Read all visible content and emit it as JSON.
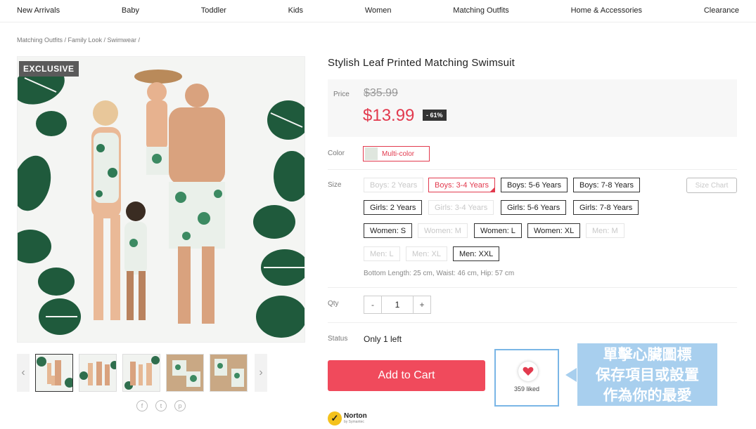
{
  "nav": [
    "New Arrivals",
    "Baby",
    "Toddler",
    "Kids",
    "Women",
    "Matching Outfits",
    "Home & Accessories",
    "Clearance"
  ],
  "breadcrumb": "Matching Outfits / Family Look / Swimwear /",
  "product": {
    "badge": "EXCLUSIVE",
    "title": "Stylish Leaf Printed Matching Swimsuit",
    "price_label": "Price",
    "old_price": "$35.99",
    "price": "$13.99",
    "discount": "- 61%",
    "color_label": "Color",
    "color": "Multi-color",
    "size_label": "Size",
    "size_chart": "Size Chart",
    "sizes": [
      [
        "Boys: 2 Years",
        "Boys: 3-4 Years",
        "Boys: 5-6 Years",
        "Boys: 7-8 Years"
      ],
      [
        "Girls: 2 Years",
        "Girls: 3-4 Years",
        "Girls: 5-6 Years",
        "Girls: 7-8 Years"
      ],
      [
        "Women: S",
        "Women: M",
        "Women: L",
        "Women: XL",
        "Men: M"
      ],
      [
        "Men: L",
        "Men: XL",
        "Men: XXL"
      ]
    ],
    "measurements": "Bottom Length: 25 cm, Waist: 46 cm, Hip: 57 cm",
    "qty_label": "Qty",
    "qty_minus": "-",
    "qty": "1",
    "qty_plus": "+",
    "status_label": "Status",
    "status": "Only 1 left",
    "add_to_cart": "Add to Cart",
    "liked": "359 liked"
  },
  "tooltip": [
    "單擊心臟圖標",
    "保存項目或設置",
    "作為你的最愛"
  ],
  "norton": {
    "name": "Norton",
    "sub": "by Symantec"
  },
  "colors": {
    "accent": "#e23a4e",
    "cart": "#f04a5c",
    "tooltip": "#a8cfee",
    "leaf": "#1f5a3c"
  },
  "icons": {
    "facebook": "facebook-icon",
    "twitter": "twitter-icon",
    "pinterest": "pinterest-icon",
    "heart": "heart-icon"
  }
}
